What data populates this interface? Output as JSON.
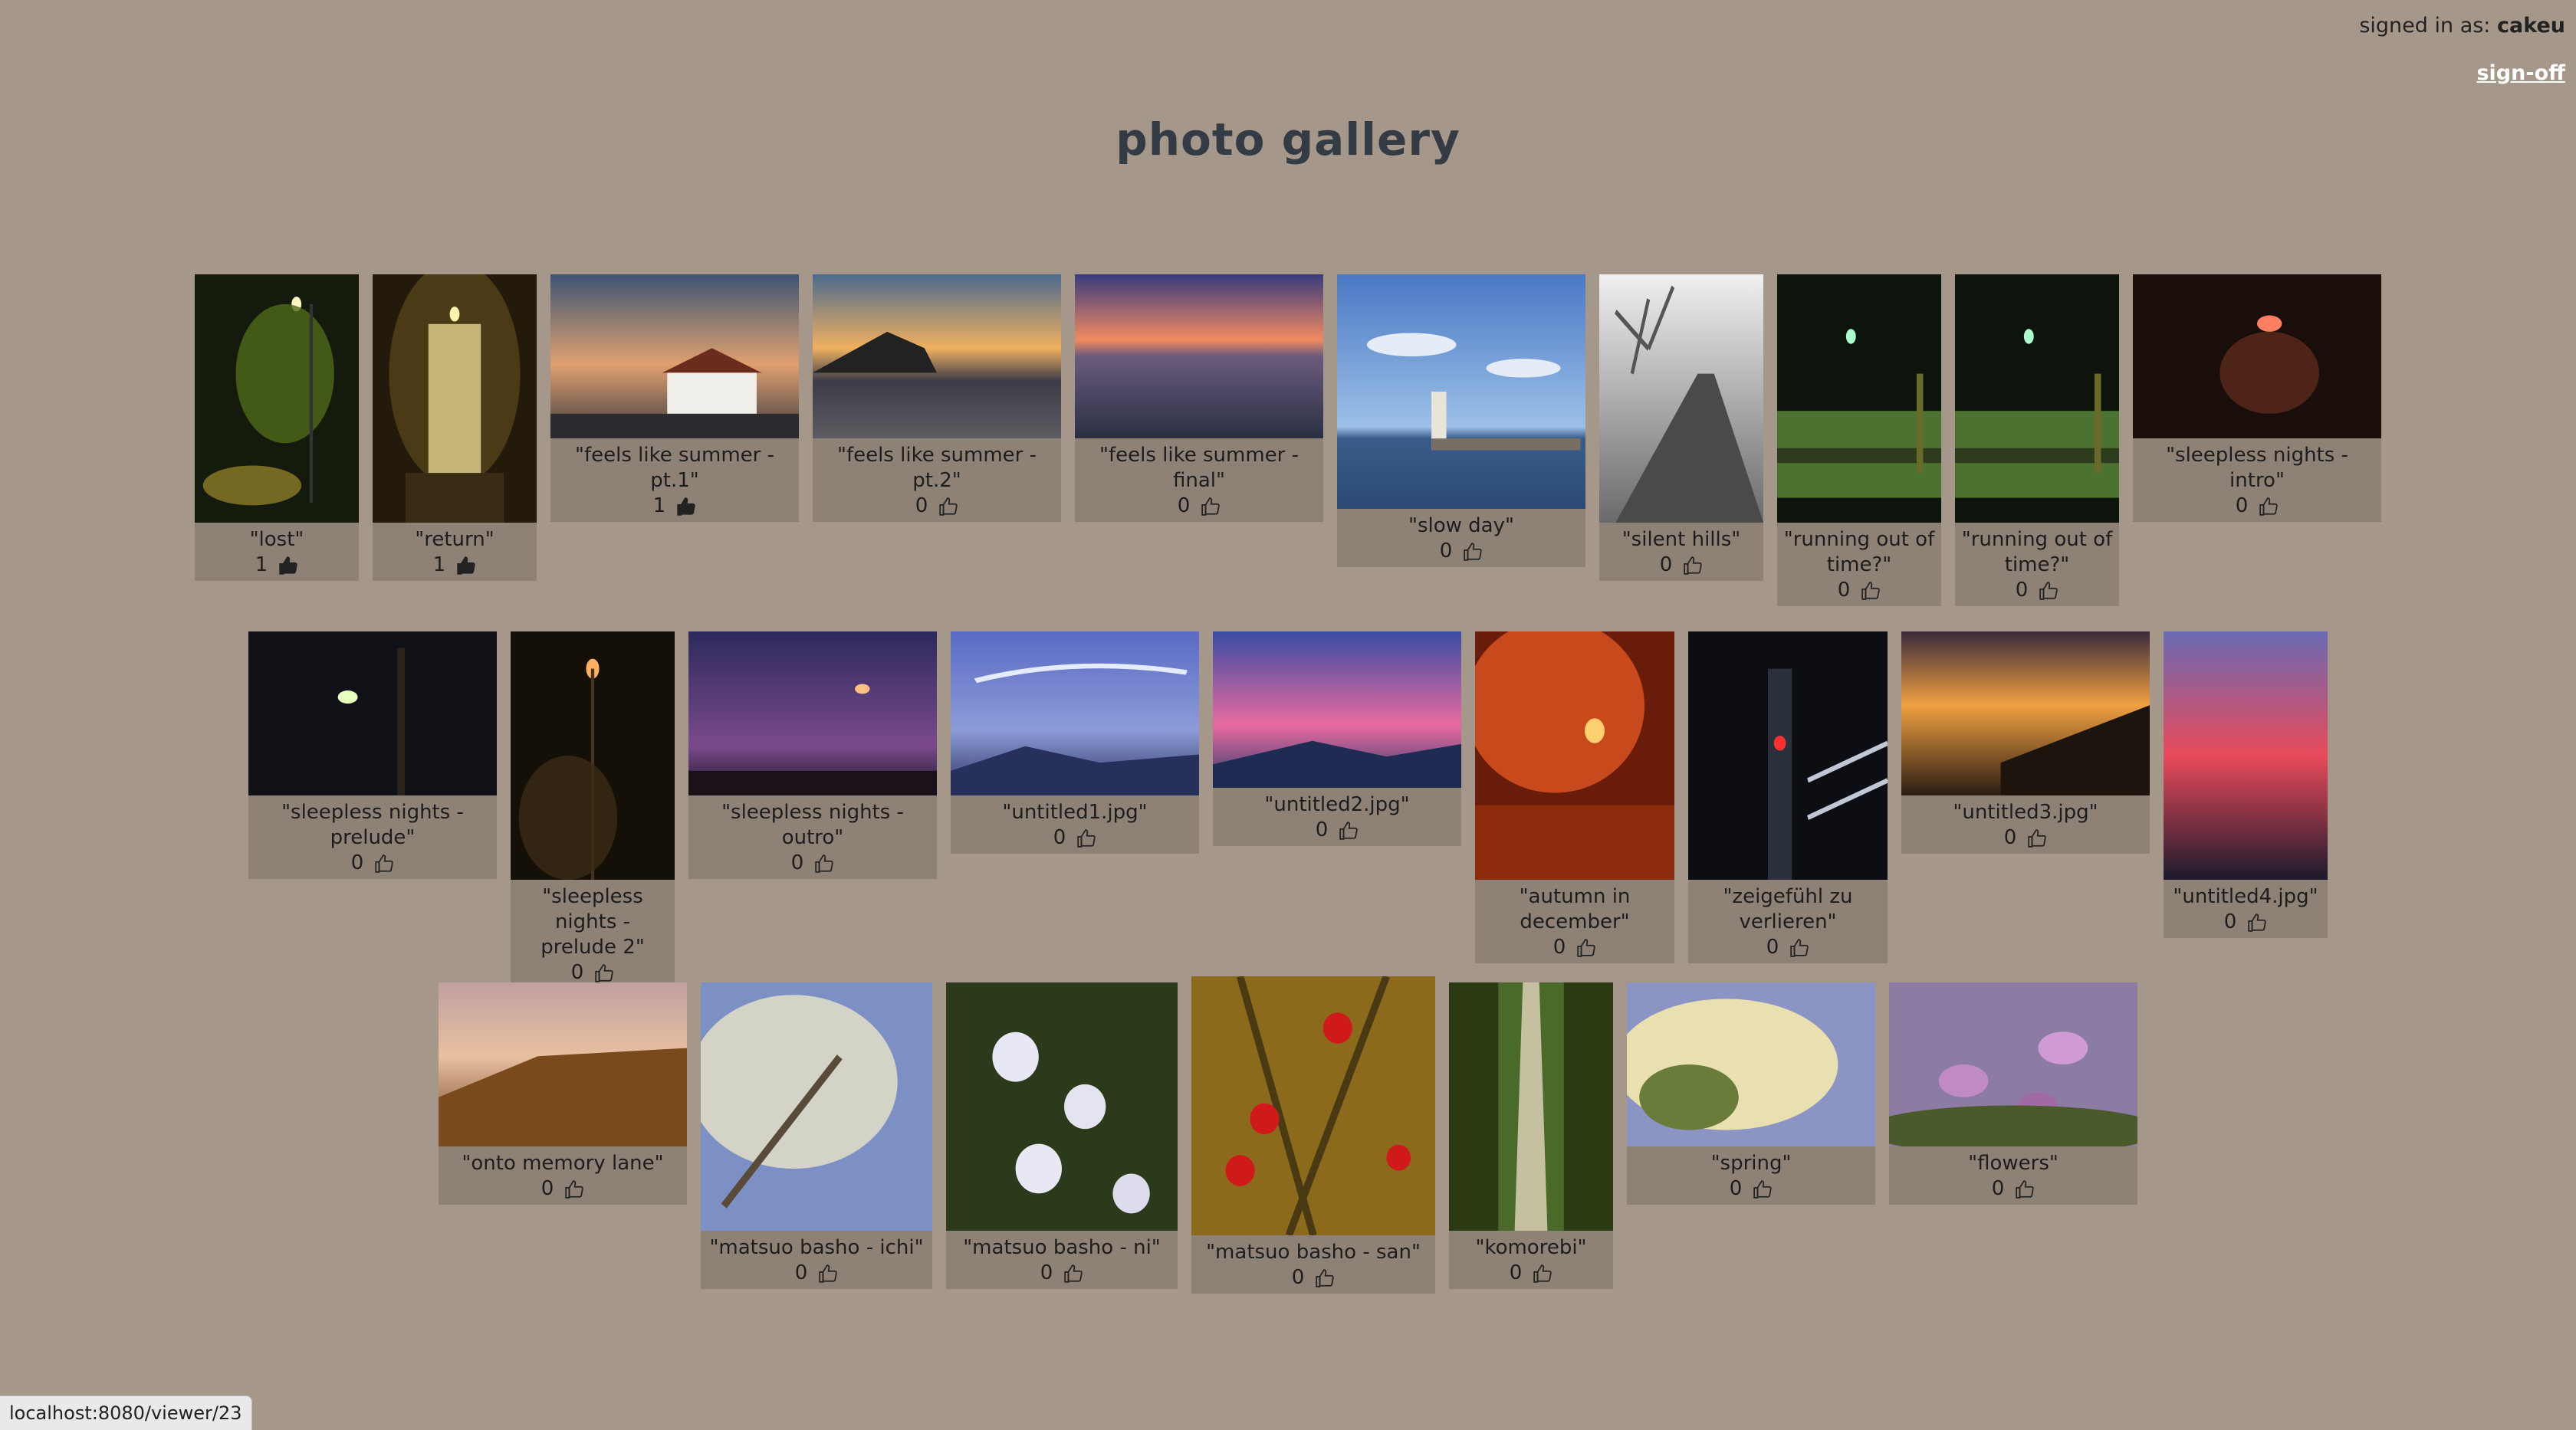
{
  "header": {
    "signed_prefix": "signed in as:",
    "user": "cakeu",
    "signoff": "sign-off",
    "title": "photo gallery"
  },
  "rows": [
    [
      {
        "caption": "\"lost\"",
        "likes": "1",
        "liked": true,
        "shape": "portrait",
        "scene": "night-trees"
      },
      {
        "caption": "\"return\"",
        "likes": "1",
        "liked": true,
        "shape": "portrait",
        "scene": "night-door"
      },
      {
        "caption": "\"feels like summer - pt.1\"",
        "likes": "1",
        "liked": true,
        "shape": "square",
        "scene": "sunset-house"
      },
      {
        "caption": "\"feels like summer - pt.2\"",
        "likes": "0",
        "liked": false,
        "shape": "square",
        "scene": "sunset-coast"
      },
      {
        "caption": "\"feels like summer - final\"",
        "likes": "0",
        "liked": false,
        "shape": "square",
        "scene": "sunset-sea"
      },
      {
        "caption": "\"slow day\"",
        "likes": "0",
        "liked": false,
        "shape": "tall-square",
        "scene": "lighthouse"
      },
      {
        "caption": "\"silent hills\"",
        "likes": "0",
        "liked": false,
        "shape": "portrait",
        "scene": "fog-bridge"
      },
      {
        "caption": "\"running out of time?\"",
        "likes": "0",
        "liked": false,
        "shape": "portrait",
        "scene": "station"
      },
      {
        "caption": "\"running out of time?\"",
        "likes": "0",
        "liked": false,
        "shape": "portrait",
        "scene": "station"
      },
      {
        "caption": "\"sleepless nights - intro\"",
        "likes": "0",
        "liked": false,
        "shape": "square",
        "scene": "night-lamp-red"
      }
    ],
    [
      {
        "caption": "\"sleepless nights - prelude\"",
        "likes": "0",
        "liked": false,
        "shape": "square",
        "scene": "night-green"
      },
      {
        "caption": "\"sleepless nights - prelude 2\"",
        "likes": "0",
        "liked": false,
        "shape": "portrait",
        "scene": "night-lamp-orange"
      },
      {
        "caption": "\"sleepless nights - outro\"",
        "likes": "0",
        "liked": false,
        "shape": "square",
        "scene": "dusk-purple"
      },
      {
        "caption": "\"untitled1.jpg\"",
        "likes": "0",
        "liked": false,
        "shape": "square",
        "scene": "clouds-blue"
      },
      {
        "caption": "\"untitled2.jpg\"",
        "likes": "0",
        "liked": false,
        "shape": "short-square",
        "scene": "pink-sky"
      },
      {
        "caption": "\"autumn in december\"",
        "likes": "0",
        "liked": false,
        "shape": "mid",
        "scene": "autumn"
      },
      {
        "caption": "\"zeigefühl zu verlieren\"",
        "likes": "0",
        "liked": false,
        "shape": "mid",
        "scene": "signal"
      },
      {
        "caption": "\"untitled3.jpg\"",
        "likes": "0",
        "liked": false,
        "shape": "square",
        "scene": "orange-sky"
      },
      {
        "caption": "\"untitled4.jpg\"",
        "likes": "0",
        "liked": false,
        "shape": "portrait",
        "scene": "red-sky"
      }
    ],
    [
      {
        "caption": "\"onto memory lane\"",
        "likes": "0",
        "liked": false,
        "shape": "square",
        "scene": "cliff-sunset"
      },
      {
        "caption": "\"matsuo basho - ichi\"",
        "likes": "0",
        "liked": false,
        "shape": "portrait-w",
        "scene": "blossom"
      },
      {
        "caption": "\"matsuo basho - ni\"",
        "likes": "0",
        "liked": false,
        "shape": "portrait-w",
        "scene": "daisies"
      },
      {
        "caption": "\"matsuo basho - san\"",
        "likes": "0",
        "liked": false,
        "shape": "sel",
        "scene": "roses"
      },
      {
        "caption": "\"komorebi\"",
        "likes": "0",
        "liked": false,
        "shape": "portrait",
        "scene": "forest"
      },
      {
        "caption": "\"spring\"",
        "likes": "0",
        "liked": false,
        "shape": "square",
        "scene": "lilac"
      },
      {
        "caption": "\"flowers\"",
        "likes": "0",
        "liked": false,
        "shape": "square",
        "scene": "asters"
      }
    ]
  ],
  "status_url": "localhost:8080/viewer/23",
  "colors": {
    "background": "#a5978a",
    "caption_bg": "#8e8276",
    "title": "#333c44"
  }
}
